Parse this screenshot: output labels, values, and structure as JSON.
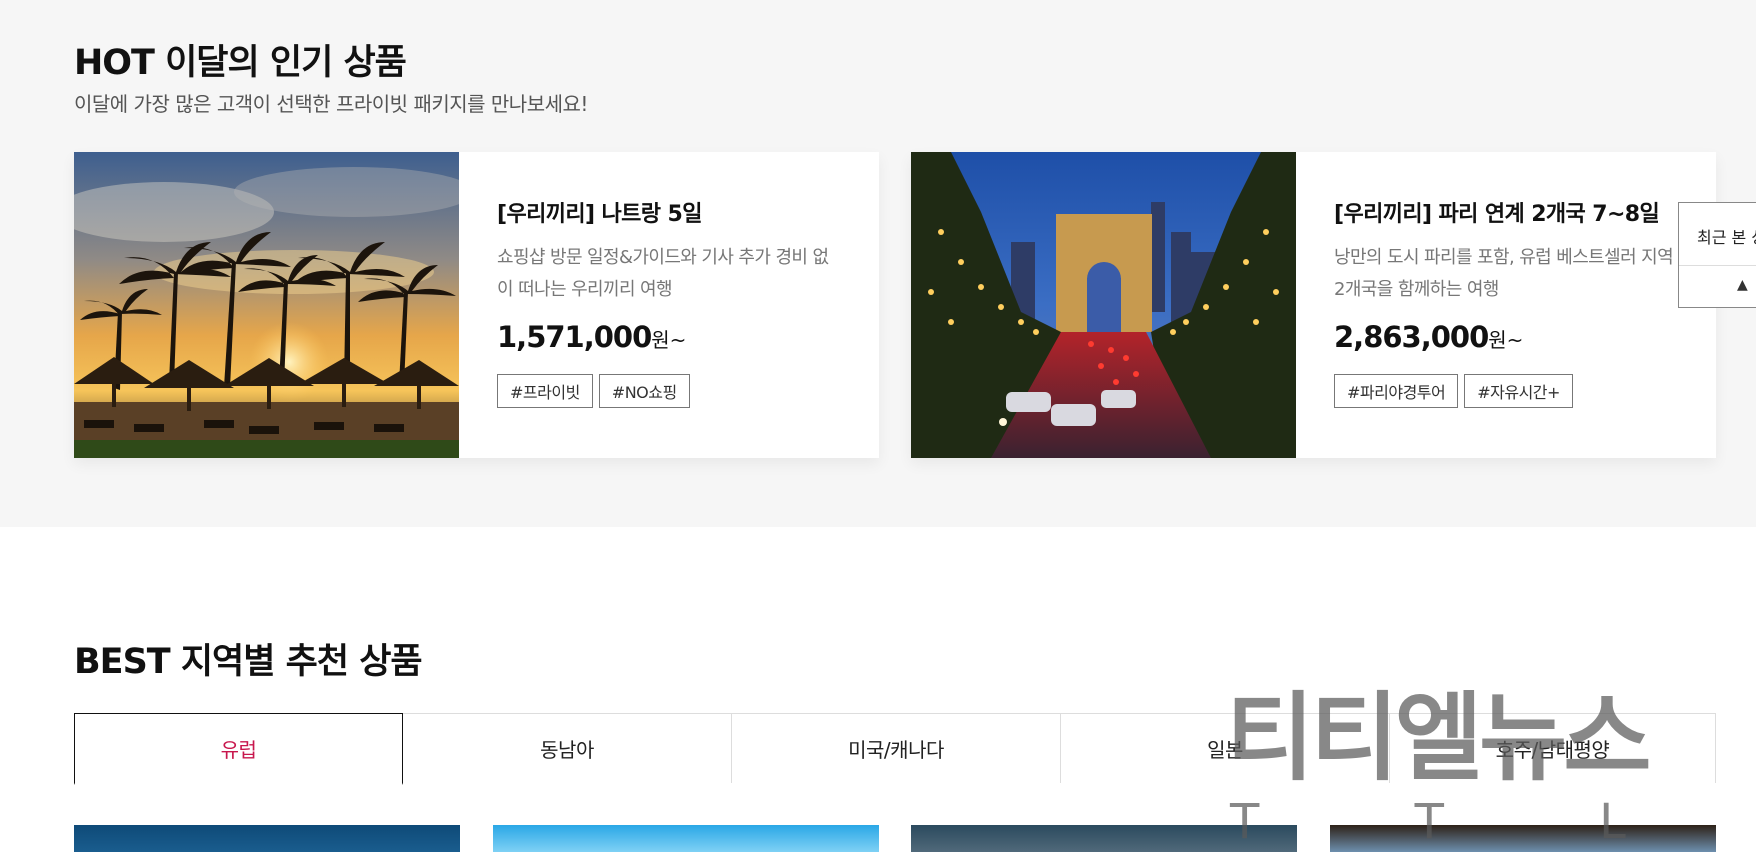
{
  "hot": {
    "title": "HOT 이달의 인기 상품",
    "subtitle": "이달에 가장 많은 고객이 선택한 프라이빗 패키지를 만나보세요!",
    "products": [
      {
        "title": "[우리끼리] 나트랑 5일",
        "description": "쇼핑샵 방문 일정&가이드와 기사 추가 경비 없이 떠나는 우리끼리 여행",
        "price": "1,571,000",
        "unit": "원~",
        "tags": [
          "#프라이빗",
          "#NO쇼핑"
        ]
      },
      {
        "title": "[우리끼리] 파리 연계 2개국 7~8일",
        "description": "낭만의 도시 파리를 포함, 유럽 베스트셀러 지역 2개국을 함께하는 여행",
        "price": "2,863,000",
        "unit": "원~",
        "tags": [
          "#파리야경투어",
          "#자유시간+"
        ]
      }
    ]
  },
  "recent_widget": {
    "label": "최근 본 상",
    "arrow": "▲"
  },
  "best": {
    "title": "BEST 지역별 추천 상품",
    "tabs": [
      {
        "label": "유럽",
        "active": true
      },
      {
        "label": "동남아",
        "active": false
      },
      {
        "label": "미국/캐나다",
        "active": false
      },
      {
        "label": "일본",
        "active": false
      },
      {
        "label": "호주/남태평양",
        "active": false
      }
    ]
  },
  "watermark": {
    "text": "티티엘뉴스",
    "sub": "T T L"
  },
  "colors": {
    "accent": "#c8174d",
    "section_bg": "#f6f6f6"
  }
}
